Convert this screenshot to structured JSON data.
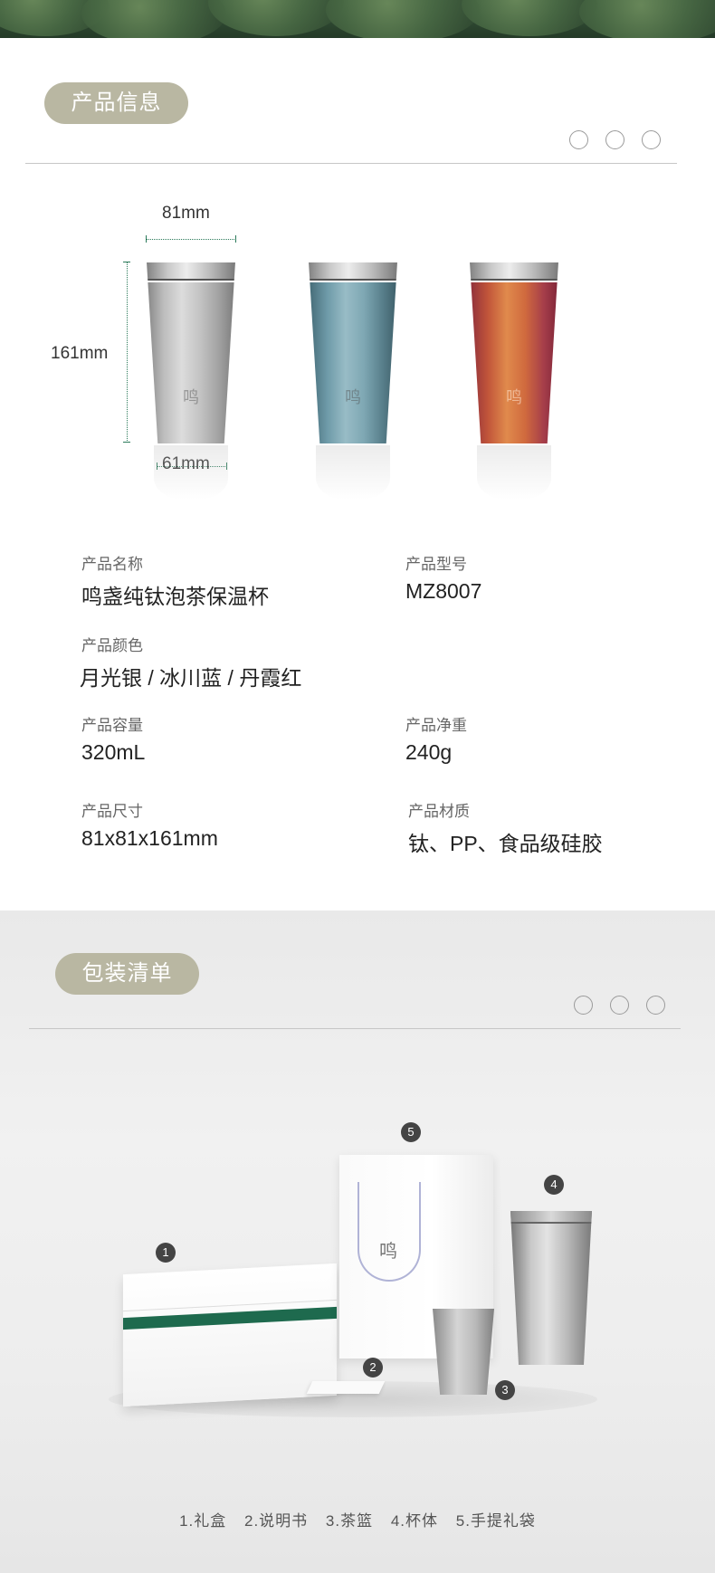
{
  "banner": {
    "alt": "tea plantation"
  },
  "info": {
    "title": "产品信息",
    "dimensions": {
      "width_top": "81mm",
      "height": "161mm",
      "width_bottom": "61mm"
    },
    "cups": [
      {
        "name": "月光银",
        "color": "#b7b7b7"
      },
      {
        "name": "冰川蓝",
        "color": "#6e9aa8"
      },
      {
        "name": "丹霞红",
        "color": "#c2563a"
      }
    ],
    "specs": {
      "name_label": "产品名称",
      "name_value": "鸣盏纯钛泡茶保温杯",
      "model_label": "产品型号",
      "model_value": "MZ8007",
      "color_label": "产品颜色",
      "color_value": "月光银 / 冰川蓝 / 丹霞红",
      "capacity_label": "产品容量",
      "capacity_value": "320mL",
      "weight_label": "产品净重",
      "weight_value": "240g",
      "size_label": "产品尺寸",
      "size_value": "81x81x161mm",
      "material_label": "产品材质",
      "material_value": "钛、PP、食品级硅胶"
    }
  },
  "package": {
    "title": "包装清单",
    "badges": [
      "1",
      "2",
      "3",
      "4",
      "5"
    ],
    "items": [
      "1.礼盒",
      "2.说明书",
      "3.茶篮",
      "4.杯体",
      "5.手提礼袋"
    ]
  },
  "colors": {
    "pill": "#b9b7a2",
    "accent_green": "#1e6a4e",
    "divider": "#c6c6c6"
  }
}
